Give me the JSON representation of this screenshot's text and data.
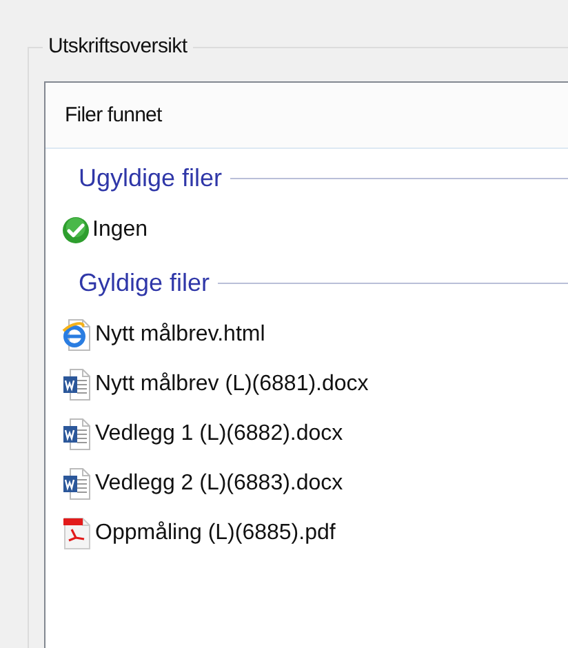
{
  "group_title": "Utskriftsoversikt",
  "panel": {
    "header": "Filer funnet",
    "sections": [
      {
        "title": "Ugyldige filer",
        "items": [
          {
            "kind": "ok",
            "label": "Ingen"
          }
        ]
      },
      {
        "title": "Gyldige filer",
        "items": [
          {
            "kind": "html",
            "label": "Nytt målbrev.html"
          },
          {
            "kind": "word",
            "label": "Nytt målbrev (L)(6881).docx"
          },
          {
            "kind": "word",
            "label": "Vedlegg 1 (L)(6882).docx"
          },
          {
            "kind": "word",
            "label": "Vedlegg 2 (L)(6883).docx"
          },
          {
            "kind": "pdf",
            "label": "Oppmåling (L)(6885).pdf"
          }
        ]
      }
    ]
  }
}
